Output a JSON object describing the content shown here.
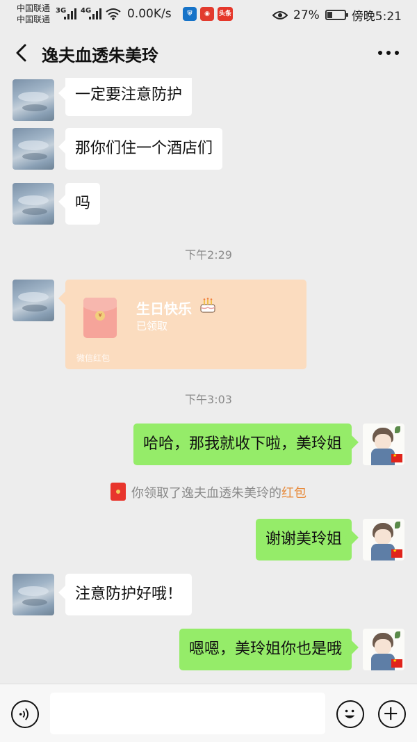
{
  "statusbar": {
    "carrier1": "中国联通",
    "carrier2": "中国联通",
    "sig1": "3G",
    "sig2": "4G",
    "net_speed": "0.00K/s",
    "app_badge": "头条",
    "battery": "27%",
    "time": "傍晚5:21"
  },
  "header": {
    "title": "逸夫血透朱美玲"
  },
  "messages": [
    {
      "side": "in",
      "text": "一定要注意防护"
    },
    {
      "side": "in",
      "text": "那你们住一个酒店们"
    },
    {
      "side": "in",
      "text": "吗"
    },
    {
      "type": "time",
      "text": "下午2:29"
    },
    {
      "type": "red_packet",
      "title": "生日快乐",
      "status": "已领取",
      "label": "微信红包"
    },
    {
      "type": "time",
      "text": "下午3:03"
    },
    {
      "side": "out",
      "text": "哈哈，那我就收下啦，美玲姐"
    },
    {
      "type": "system",
      "text_before": "你领取了逸夫血透朱美玲的",
      "highlight": "红包"
    },
    {
      "side": "out",
      "text": "谢谢美玲姐"
    },
    {
      "side": "in",
      "text": "注意防护好哦！"
    },
    {
      "side": "out",
      "text": "嗯嗯，美玲姐你也是哦"
    }
  ],
  "input": {
    "placeholder": ""
  },
  "colors": {
    "background": "#ededed",
    "bubble_out": "#95ec69",
    "bubble_in": "#ffffff",
    "red_packet": "#fbdcbf",
    "highlight": "#e88a3a"
  }
}
